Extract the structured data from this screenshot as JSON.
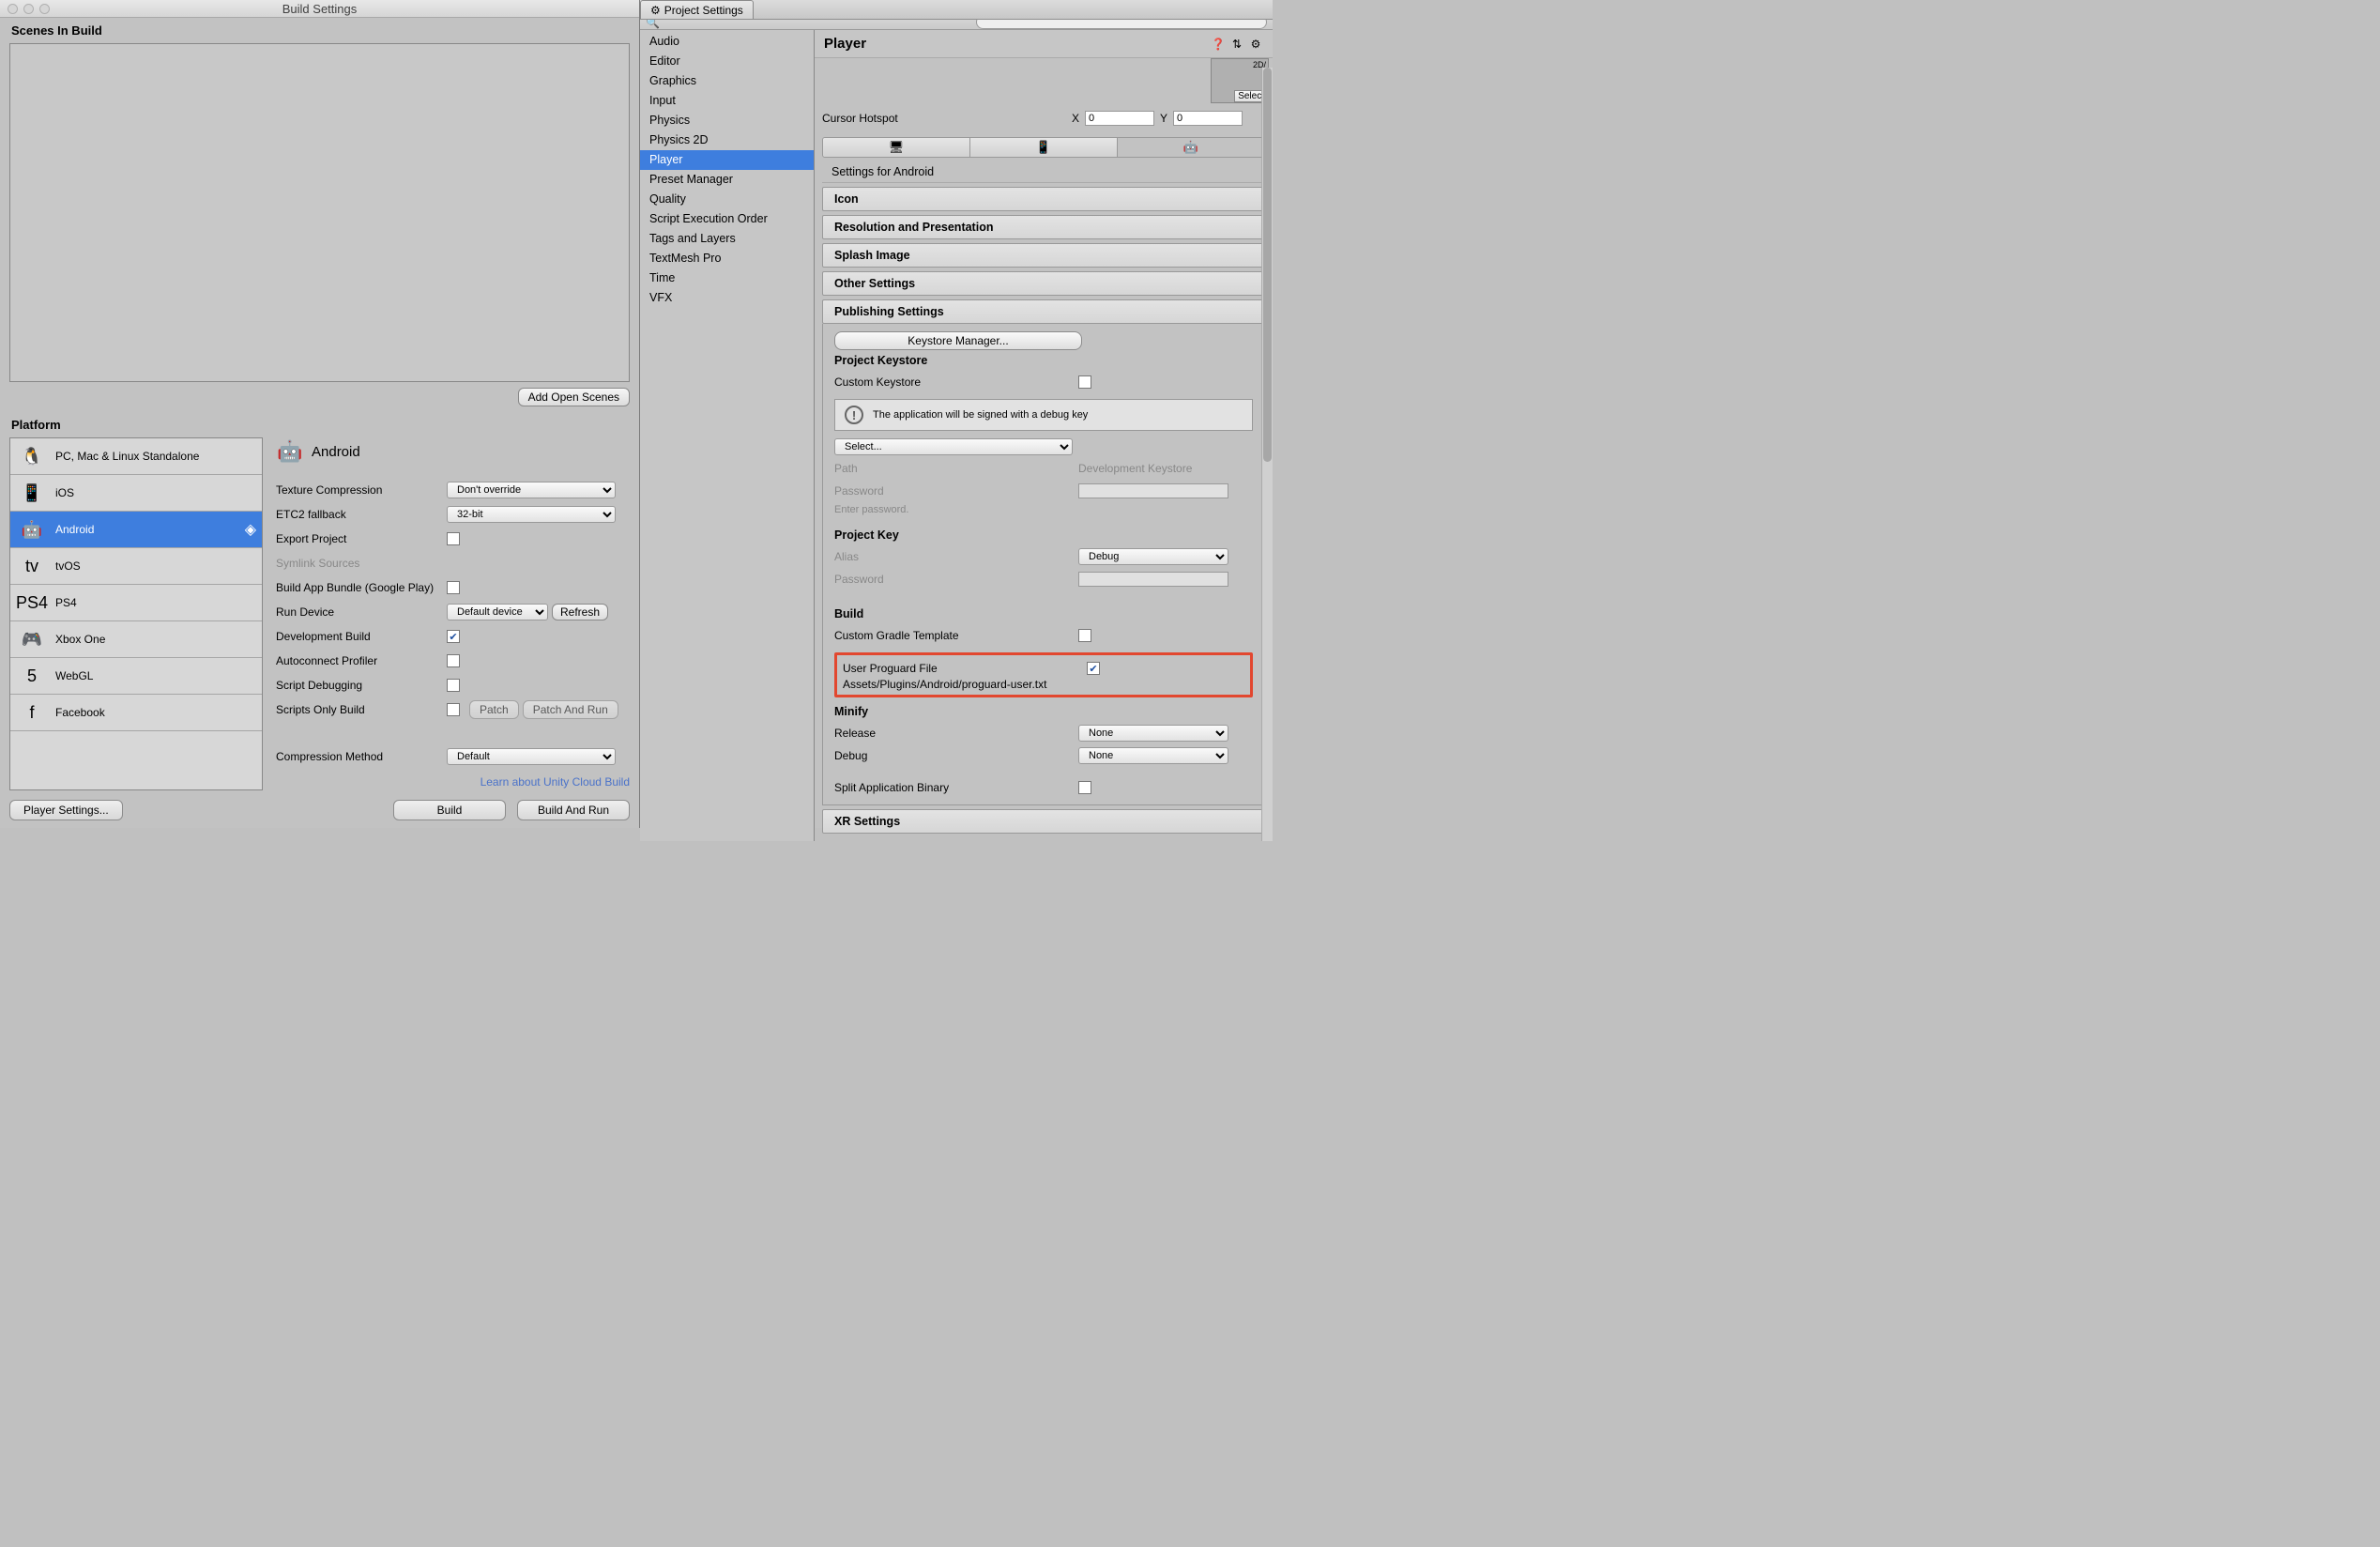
{
  "buildWin": {
    "title": "Build Settings",
    "scenesHeader": "Scenes In Build",
    "addOpenScenes": "Add Open Scenes",
    "platformHeader": "Platform",
    "platforms": [
      {
        "label": "PC, Mac & Linux Standalone",
        "icon": "🐧",
        "selected": false
      },
      {
        "label": "iOS",
        "icon": "📱",
        "selected": false
      },
      {
        "label": "Android",
        "icon": "🤖",
        "selected": true
      },
      {
        "label": "tvOS",
        "icon": "tv",
        "selected": false
      },
      {
        "label": "PS4",
        "icon": "PS4",
        "selected": false
      },
      {
        "label": "Xbox One",
        "icon": "🎮",
        "selected": false
      },
      {
        "label": "WebGL",
        "icon": "5",
        "selected": false
      },
      {
        "label": "Facebook",
        "icon": "f",
        "selected": false
      }
    ],
    "detailTitle": "Android",
    "fields": {
      "textureCompression": {
        "label": "Texture Compression",
        "value": "Don't override"
      },
      "etc2Fallback": {
        "label": "ETC2 fallback",
        "value": "32-bit"
      },
      "exportProject": {
        "label": "Export Project",
        "checked": false
      },
      "symlink": {
        "label": "Symlink Sources",
        "disabled": true
      },
      "buildAppBundle": {
        "label": "Build App Bundle (Google Play)",
        "checked": false
      },
      "runDevice": {
        "label": "Run Device",
        "value": "Default device",
        "refresh": "Refresh"
      },
      "devBuild": {
        "label": "Development Build",
        "checked": true
      },
      "autoconnect": {
        "label": "Autoconnect Profiler",
        "checked": false
      },
      "scriptDebugging": {
        "label": "Script Debugging",
        "checked": false
      },
      "scriptsOnly": {
        "label": "Scripts Only Build",
        "checked": false,
        "patch": "Patch",
        "patchRun": "Patch And Run"
      },
      "compression": {
        "label": "Compression Method",
        "value": "Default"
      },
      "cloudLink": "Learn about Unity Cloud Build",
      "playerSettings": "Player Settings...",
      "build": "Build",
      "buildRun": "Build And Run"
    }
  },
  "psWin": {
    "tabLabel": "Project Settings",
    "searchPlaceholder": "",
    "categories": [
      "Audio",
      "Editor",
      "Graphics",
      "Input",
      "Physics",
      "Physics 2D",
      "Player",
      "Preset Manager",
      "Quality",
      "Script Execution Order",
      "Tags and Layers",
      "TextMesh Pro",
      "Time",
      "VFX"
    ],
    "selectedCategory": "Player",
    "detailTitle": "Player",
    "thumbTag": "2D/",
    "selectBtn": "Select",
    "cursorHotspot": {
      "label": "Cursor Hotspot",
      "xLabel": "X",
      "yLabel": "Y",
      "x": "0",
      "y": "0"
    },
    "settingsFor": "Settings for Android",
    "sections": {
      "icon": "Icon",
      "resPres": "Resolution and Presentation",
      "splash": "Splash Image",
      "other": "Other Settings",
      "publishing": "Publishing Settings",
      "xr": "XR Settings"
    },
    "publishing": {
      "keystoreMgr": "Keystore Manager...",
      "projectKeystore": "Project Keystore",
      "customKeystore": {
        "label": "Custom Keystore",
        "checked": false
      },
      "infoMsg": "The application will be signed with a debug key",
      "keystoreSelect": "Select...",
      "pathLabel": "Path",
      "pathValue": "Development Keystore",
      "pwdLabel": "Password",
      "pwdHint": "Enter password.",
      "projectKey": "Project Key",
      "aliasLabel": "Alias",
      "aliasValue": "Debug",
      "keyPwdLabel": "Password",
      "buildHeader": "Build",
      "customGradle": {
        "label": "Custom Gradle Template",
        "checked": false
      },
      "userProguard": {
        "label": "User Proguard File",
        "checked": true,
        "path": "Assets/Plugins/Android/proguard-user.txt"
      },
      "minify": "Minify",
      "release": {
        "label": "Release",
        "value": "None"
      },
      "debug": {
        "label": "Debug",
        "value": "None"
      },
      "splitBinary": {
        "label": "Split Application Binary",
        "checked": false
      }
    }
  }
}
